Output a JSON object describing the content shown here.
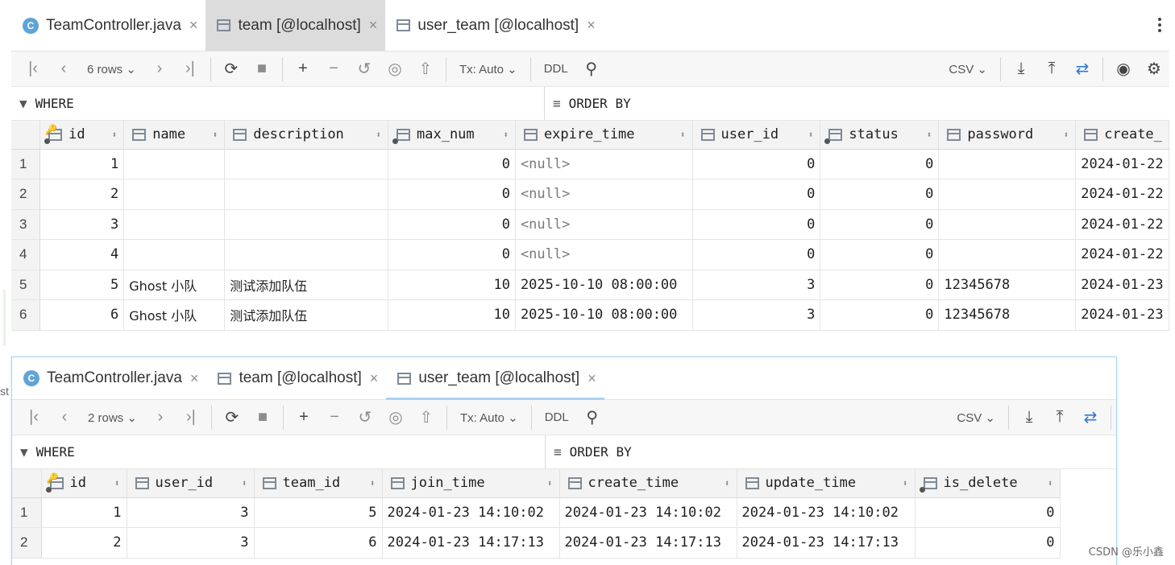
{
  "colors": {
    "accent_blue": "#2e7ad1",
    "tab_underline": "#a9d2f2",
    "header_bg": "#f3f3f3",
    "null_text": "#7a7a7a"
  },
  "top": {
    "tabs": [
      {
        "label": "TeamController.java",
        "icon": "c-class-icon",
        "close": "×"
      },
      {
        "label": "team [@localhost]",
        "icon": "table-icon",
        "close": "×"
      },
      {
        "label": "user_team [@localhost]",
        "icon": "table-icon",
        "close": "×"
      }
    ],
    "toolbar": {
      "rows": "6 rows",
      "tx": "Tx: Auto",
      "ddl": "DDL",
      "csv": "CSV"
    },
    "filter": {
      "where": "WHERE",
      "order": "ORDER BY"
    },
    "columns": [
      "id",
      "name",
      "description",
      "max_num",
      "expire_time",
      "user_id",
      "status",
      "password",
      "create_"
    ],
    "rows": [
      {
        "rn": "1",
        "id": "1",
        "name": "",
        "description": "",
        "max_num": "0",
        "expire_time": "<null>",
        "user_id": "0",
        "status": "0",
        "password": "",
        "create": "2024-01-22"
      },
      {
        "rn": "2",
        "id": "2",
        "name": "",
        "description": "",
        "max_num": "0",
        "expire_time": "<null>",
        "user_id": "0",
        "status": "0",
        "password": "",
        "create": "2024-01-22"
      },
      {
        "rn": "3",
        "id": "3",
        "name": "",
        "description": "",
        "max_num": "0",
        "expire_time": "<null>",
        "user_id": "0",
        "status": "0",
        "password": "",
        "create": "2024-01-22"
      },
      {
        "rn": "4",
        "id": "4",
        "name": "",
        "description": "",
        "max_num": "0",
        "expire_time": "<null>",
        "user_id": "0",
        "status": "0",
        "password": "",
        "create": "2024-01-22"
      },
      {
        "rn": "5",
        "id": "5",
        "name": "Ghost 小队",
        "description": "测试添加队伍",
        "max_num": "10",
        "expire_time": "2025-10-10 08:00:00",
        "user_id": "3",
        "status": "0",
        "password": "12345678",
        "create": "2024-01-23"
      },
      {
        "rn": "6",
        "id": "6",
        "name": "Ghost 小队",
        "description": "测试添加队伍",
        "max_num": "10",
        "expire_time": "2025-10-10 08:00:00",
        "user_id": "3",
        "status": "0",
        "password": "12345678",
        "create": "2024-01-23"
      }
    ]
  },
  "bottom": {
    "tabs": [
      {
        "label": "TeamController.java",
        "icon": "c-class-icon",
        "close": "×"
      },
      {
        "label": "team [@localhost]",
        "icon": "table-icon",
        "close": "×"
      },
      {
        "label": "user_team [@localhost]",
        "icon": "table-icon",
        "close": "×"
      }
    ],
    "toolbar": {
      "rows": "2 rows",
      "tx": "Tx: Auto",
      "ddl": "DDL",
      "csv": "CSV"
    },
    "filter": {
      "where": "WHERE",
      "order": "ORDER BY"
    },
    "columns": [
      "id",
      "user_id",
      "team_id",
      "join_time",
      "create_time",
      "update_time",
      "is_delete"
    ],
    "rows": [
      {
        "rn": "1",
        "id": "1",
        "user_id": "3",
        "team_id": "5",
        "join_time": "2024-01-23 14:10:02",
        "create_time": "2024-01-23 14:10:02",
        "update_time": "2024-01-23 14:10:02",
        "is_delete": "0"
      },
      {
        "rn": "2",
        "id": "2",
        "user_id": "3",
        "team_id": "6",
        "join_time": "2024-01-23 14:17:13",
        "create_time": "2024-01-23 14:17:13",
        "update_time": "2024-01-23 14:17:13",
        "is_delete": "0"
      }
    ]
  },
  "watermark": "CSDN @乐小鑫",
  "edge_text": "st"
}
